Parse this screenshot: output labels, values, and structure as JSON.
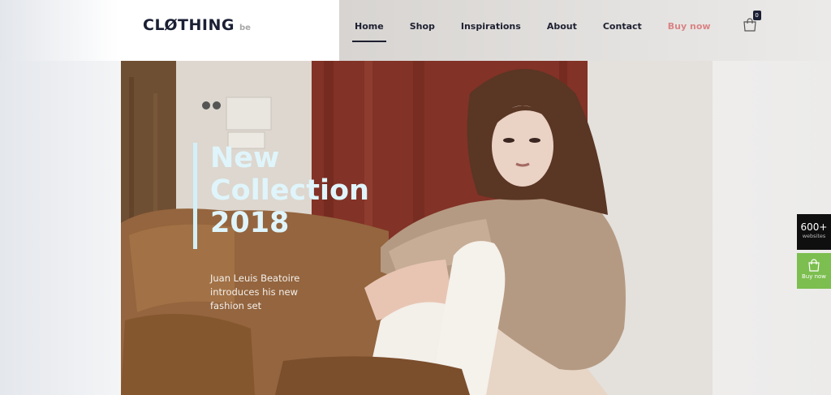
{
  "header": {
    "logo": {
      "text": "CLØTHING",
      "suffix": "be"
    },
    "nav": [
      {
        "label": "Home",
        "active": true
      },
      {
        "label": "Shop"
      },
      {
        "label": "Inspirations"
      },
      {
        "label": "About"
      },
      {
        "label": "Contact"
      },
      {
        "label": "Buy now",
        "highlight": true
      }
    ],
    "cart": {
      "icon": "shopping-bag-icon",
      "count": "0"
    }
  },
  "hero": {
    "title": "New\nCollection\n2018",
    "subtitle": "Juan Leuis Beatoire\nintroduces his new\nfashion set",
    "next_icon": "arrow-right-icon"
  },
  "side": {
    "websites_count": "600+",
    "websites_label": "websites",
    "buy_label": "Buy now",
    "buy_icon": "shopping-bag-icon"
  },
  "colors": {
    "brand_dark": "#1b1f33",
    "buy_link": "#d98485",
    "title_text": "#dff5fb",
    "side_green": "#7cbe4f",
    "side_black": "#0f0f10"
  }
}
